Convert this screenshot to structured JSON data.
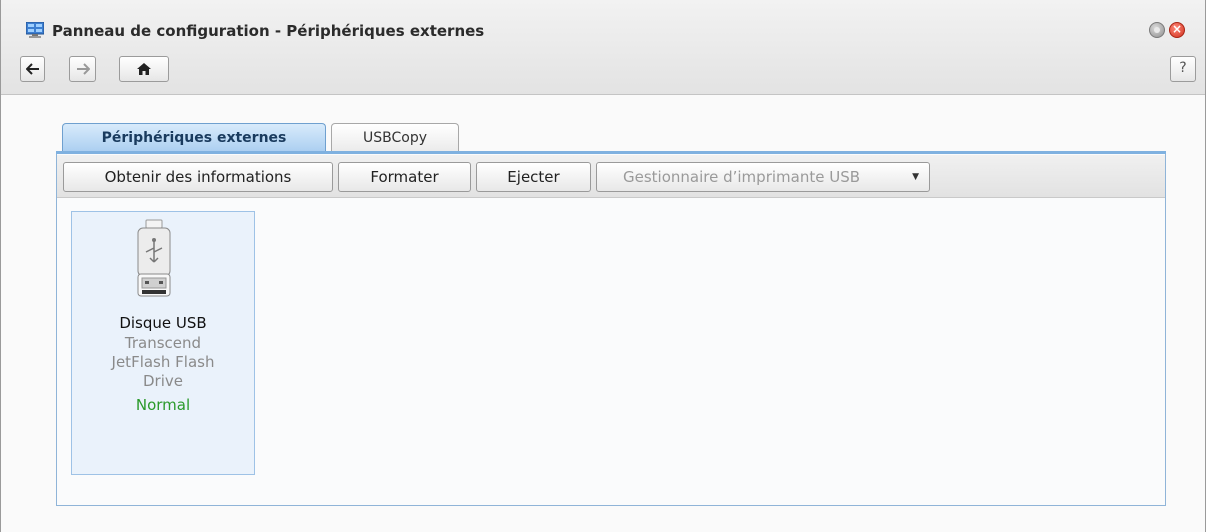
{
  "window": {
    "title": "Panneau de configuration - Périphériques externes",
    "app_icon": "control-panel-icon",
    "controls": {
      "minimize_icon": "minimize-icon",
      "close_icon": "close-icon",
      "close_glyph": "×"
    }
  },
  "nav": {
    "back_icon": "arrow-left-icon",
    "forward_icon": "arrow-right-icon",
    "home_icon": "home-icon",
    "help_label": "?"
  },
  "tabs": [
    {
      "label": "Périphériques externes",
      "active": true
    },
    {
      "label": "USBCopy",
      "active": false
    }
  ],
  "toolbar": {
    "info_label": "Obtenir des informations",
    "format_label": "Formater",
    "eject_label": "Ejecter",
    "printer_label": "Gestionnaire d’imprimante USB",
    "printer_enabled": false
  },
  "devices": [
    {
      "icon": "usb-drive-icon",
      "name": "Disque USB",
      "model_line1": "Transcend",
      "model_line2": "JetFlash Flash",
      "model_line3": "Drive",
      "status": "Normal",
      "status_color": "#2a9a2a"
    }
  ],
  "colors": {
    "accent": "#7fb1e0",
    "tab_active_bg": "#a9cdf0",
    "selection_bg": "#eaf2fb"
  }
}
